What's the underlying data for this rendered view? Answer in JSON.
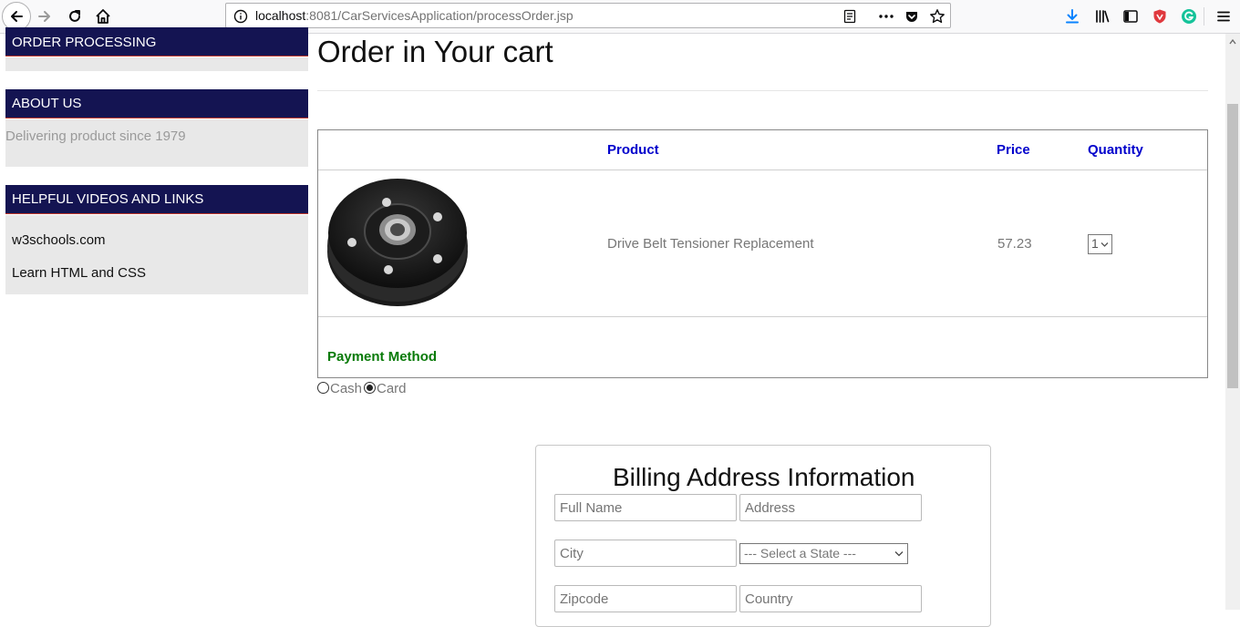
{
  "browser": {
    "url_host": "localhost",
    "url_rest": ":8081/CarServicesApplication/processOrder.jsp"
  },
  "sidebar": {
    "order_processing": "ORDER PROCESSING",
    "about_heading": "ABOUT US",
    "about_text": "Delivering product since 1979",
    "links_heading": "HELPFUL VIDEOS AND LINKS",
    "links": [
      "w3schools.com",
      "Learn HTML and CSS"
    ]
  },
  "main": {
    "title": "Order in Your cart",
    "table": {
      "headers": {
        "product": "Product",
        "price": "Price",
        "quantity": "Quantity"
      },
      "rows": [
        {
          "product": "Drive Belt Tensioner Replacement",
          "price": "57.23",
          "quantity": "1"
        }
      ]
    },
    "payment_label": "Payment Method",
    "payment_options": [
      {
        "label": "Cash",
        "checked": false
      },
      {
        "label": "Card",
        "checked": true
      }
    ]
  },
  "billing": {
    "title": "Billing Address Information",
    "full_name_placeholder": "Full Name",
    "address_placeholder": "Address",
    "city_placeholder": "City",
    "state_selected": "--- Select a State ---",
    "zipcode_placeholder": "Zipcode",
    "country_placeholder": "Country"
  },
  "colors": {
    "sidebar_header": "#141452",
    "table_header_text": "#0000cc",
    "payment_label": "#087a08"
  }
}
